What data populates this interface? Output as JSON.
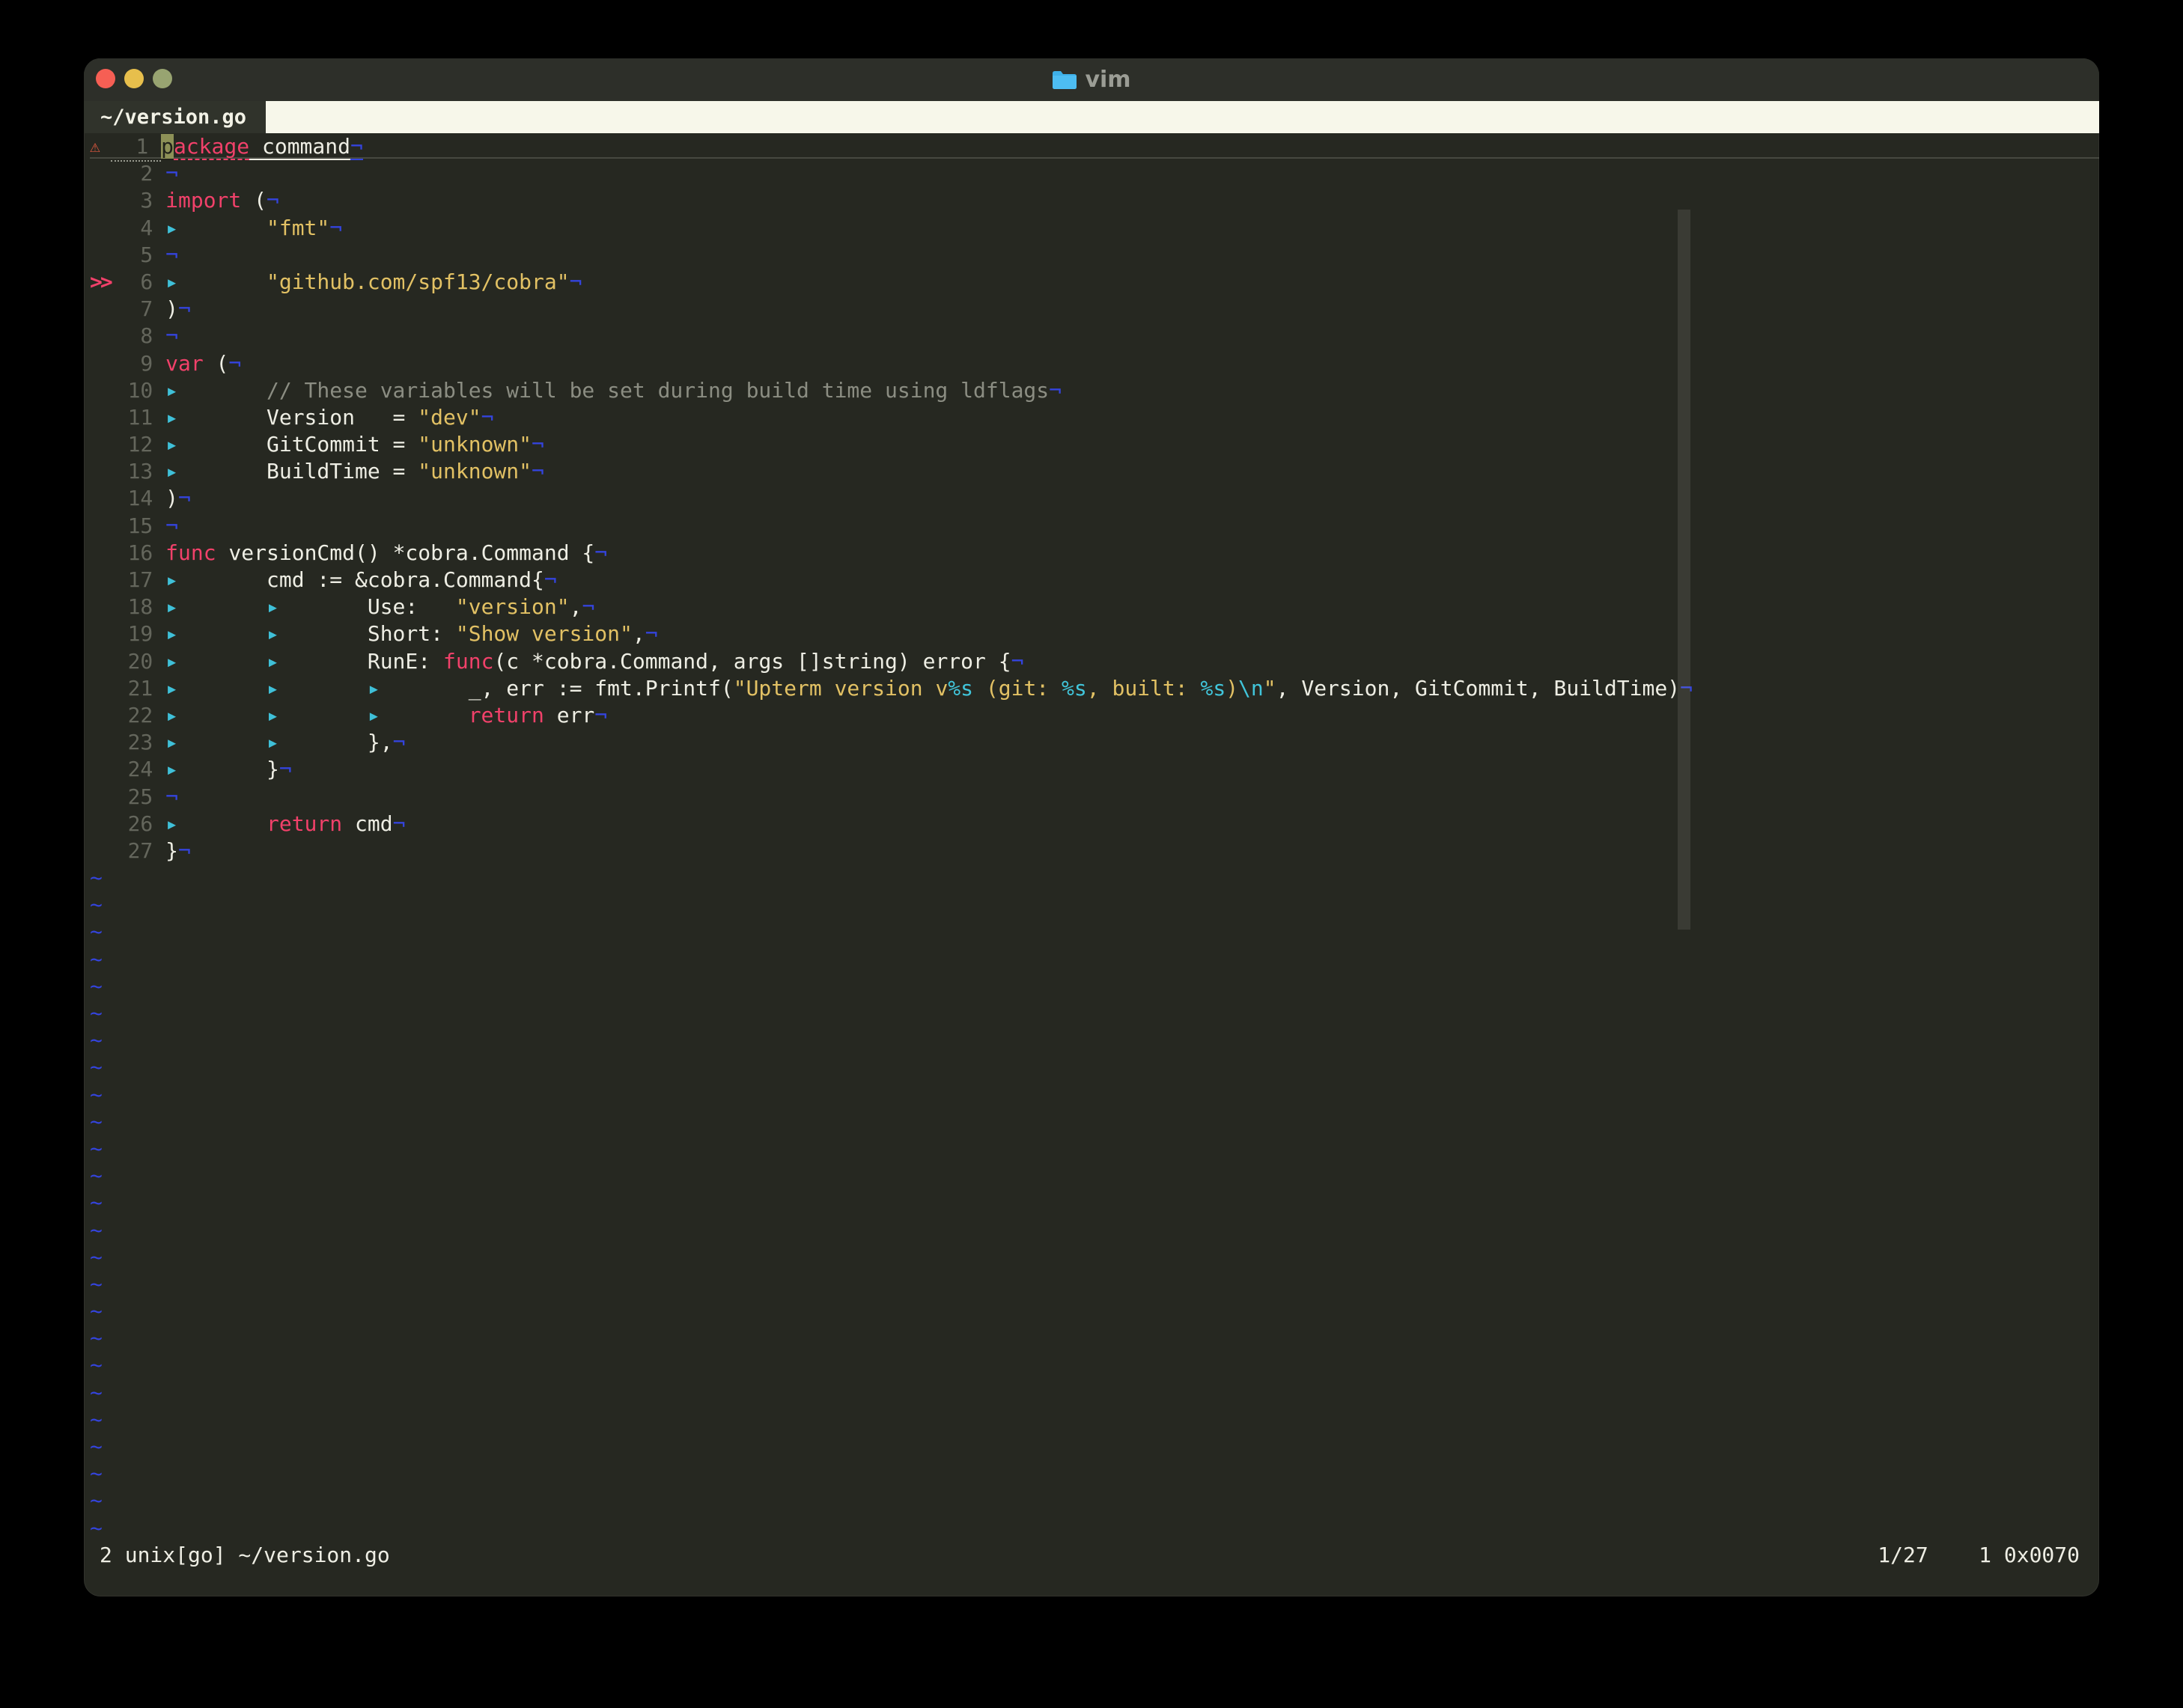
{
  "window": {
    "title": "vim",
    "traffic_lights": [
      "close",
      "minimize",
      "zoom"
    ]
  },
  "tab": {
    "label": "~/version.go"
  },
  "editor": {
    "eol_marker": "¬",
    "tab_marker": "▸",
    "tilde_marker": "~",
    "tilde_count": 25,
    "signs": {
      "warn": "⚠",
      "mark": ">>"
    },
    "lines": [
      {
        "n": 1,
        "sign": "warn",
        "cursor_line": true,
        "segs": [
          {
            "c": "cur",
            "t": "p"
          },
          {
            "c": "kw",
            "t": "ackage"
          },
          {
            "c": "txt",
            "t": " command"
          }
        ]
      },
      {
        "n": 2,
        "segs": []
      },
      {
        "n": 3,
        "segs": [
          {
            "c": "kw",
            "t": "import"
          },
          {
            "c": "txt",
            "t": " ("
          }
        ]
      },
      {
        "n": 4,
        "segs": [
          {
            "c": "tab"
          },
          {
            "c": "str",
            "t": "\"fmt\""
          }
        ]
      },
      {
        "n": 5,
        "segs": []
      },
      {
        "n": 6,
        "sign": "mark",
        "segs": [
          {
            "c": "tab"
          },
          {
            "c": "str",
            "t": "\"github.com/spf13/cobra\""
          }
        ]
      },
      {
        "n": 7,
        "segs": [
          {
            "c": "txt",
            "t": ")"
          }
        ]
      },
      {
        "n": 8,
        "segs": []
      },
      {
        "n": 9,
        "segs": [
          {
            "c": "kw",
            "t": "var"
          },
          {
            "c": "txt",
            "t": " ("
          }
        ]
      },
      {
        "n": 10,
        "segs": [
          {
            "c": "tab"
          },
          {
            "c": "com",
            "t": "// These variables will be set during build time using ldflags"
          }
        ]
      },
      {
        "n": 11,
        "segs": [
          {
            "c": "tab"
          },
          {
            "c": "txt",
            "t": "Version   = "
          },
          {
            "c": "str",
            "t": "\"dev\""
          }
        ]
      },
      {
        "n": 12,
        "segs": [
          {
            "c": "tab"
          },
          {
            "c": "txt",
            "t": "GitCommit = "
          },
          {
            "c": "str",
            "t": "\"unknown\""
          }
        ]
      },
      {
        "n": 13,
        "segs": [
          {
            "c": "tab"
          },
          {
            "c": "txt",
            "t": "BuildTime = "
          },
          {
            "c": "str",
            "t": "\"unknown\""
          }
        ]
      },
      {
        "n": 14,
        "segs": [
          {
            "c": "txt",
            "t": ")"
          }
        ]
      },
      {
        "n": 15,
        "segs": []
      },
      {
        "n": 16,
        "segs": [
          {
            "c": "kw",
            "t": "func"
          },
          {
            "c": "txt",
            "t": " versionCmd() *cobra.Command {"
          }
        ]
      },
      {
        "n": 17,
        "segs": [
          {
            "c": "tab"
          },
          {
            "c": "txt",
            "t": "cmd := &cobra.Command{"
          }
        ]
      },
      {
        "n": 18,
        "segs": [
          {
            "c": "tab"
          },
          {
            "c": "tab"
          },
          {
            "c": "txt",
            "t": "Use:   "
          },
          {
            "c": "str",
            "t": "\"version\""
          },
          {
            "c": "txt",
            "t": ","
          }
        ]
      },
      {
        "n": 19,
        "segs": [
          {
            "c": "tab"
          },
          {
            "c": "tab"
          },
          {
            "c": "txt",
            "t": "Short: "
          },
          {
            "c": "str",
            "t": "\"Show version\""
          },
          {
            "c": "txt",
            "t": ","
          }
        ]
      },
      {
        "n": 20,
        "segs": [
          {
            "c": "tab"
          },
          {
            "c": "tab"
          },
          {
            "c": "txt",
            "t": "RunE: "
          },
          {
            "c": "kw",
            "t": "func"
          },
          {
            "c": "txt",
            "t": "(c *cobra.Command, args []string) error {"
          }
        ]
      },
      {
        "n": 21,
        "segs": [
          {
            "c": "tab"
          },
          {
            "c": "tab"
          },
          {
            "c": "tab"
          },
          {
            "c": "txt",
            "t": "_, err := fmt.Printf("
          },
          {
            "c": "str",
            "t": "\"Upterm version v"
          },
          {
            "c": "esc",
            "t": "%s"
          },
          {
            "c": "str",
            "t": " (git: "
          },
          {
            "c": "esc",
            "t": "%s"
          },
          {
            "c": "str",
            "t": ", built: "
          },
          {
            "c": "esc",
            "t": "%s"
          },
          {
            "c": "str",
            "t": ")"
          },
          {
            "c": "esc",
            "t": "\\n"
          },
          {
            "c": "str",
            "t": "\""
          },
          {
            "c": "txt",
            "t": ", Version, GitCommit, BuildTime)"
          }
        ]
      },
      {
        "n": 22,
        "segs": [
          {
            "c": "tab"
          },
          {
            "c": "tab"
          },
          {
            "c": "tab"
          },
          {
            "c": "kw",
            "t": "return"
          },
          {
            "c": "txt",
            "t": " err"
          }
        ]
      },
      {
        "n": 23,
        "segs": [
          {
            "c": "tab"
          },
          {
            "c": "tab"
          },
          {
            "c": "txt",
            "t": "},"
          }
        ]
      },
      {
        "n": 24,
        "segs": [
          {
            "c": "tab"
          },
          {
            "c": "txt",
            "t": "}"
          }
        ]
      },
      {
        "n": 25,
        "segs": []
      },
      {
        "n": 26,
        "segs": [
          {
            "c": "tab"
          },
          {
            "c": "kw",
            "t": "return"
          },
          {
            "c": "txt",
            "t": " cmd"
          }
        ]
      },
      {
        "n": 27,
        "segs": [
          {
            "c": "txt",
            "t": "}"
          }
        ]
      }
    ]
  },
  "statusbar": {
    "left": "2 unix[go] ~/version.go",
    "right": "1/27    1 0x0070"
  },
  "colors": {
    "background": "#262821",
    "titlebar": "#2d2f29",
    "tabbar": "#f7f7ea",
    "active_tab": "#30332b",
    "text": "#eeeee4",
    "keyword": "#f1416a",
    "string": "#e2c164",
    "format_spec": "#41c5da",
    "comment": "#8b8d82",
    "line_number": "#64665c",
    "eol_tilde_blue": "#3444dd",
    "tab_marker_cyan": "#3fc0d8",
    "cursor": "#8d9157",
    "warning_sign": "#e2593f",
    "light_red": "#f65f54",
    "light_yellow": "#e7bf4c",
    "light_green": "#98a471"
  }
}
